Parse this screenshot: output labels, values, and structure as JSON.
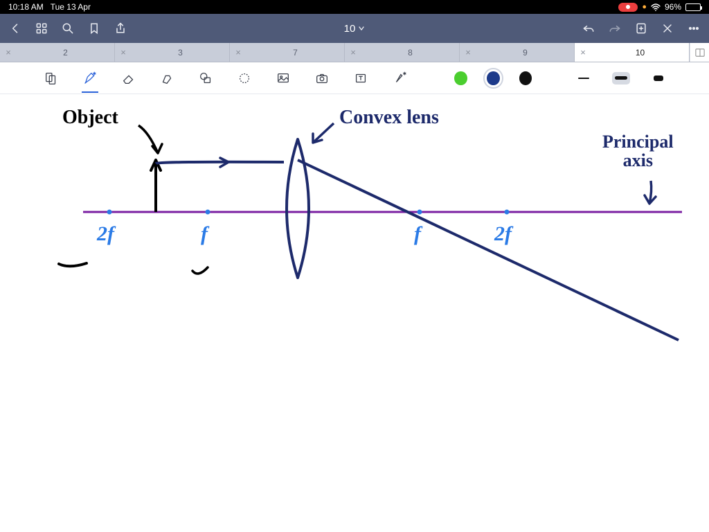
{
  "status": {
    "time": "10:18 AM",
    "date": "Tue 13 Apr",
    "battery_pct": "96%"
  },
  "toolbar": {
    "title": "10"
  },
  "tabs": [
    {
      "label": "2",
      "active": false
    },
    {
      "label": "3",
      "active": false
    },
    {
      "label": "7",
      "active": false
    },
    {
      "label": "8",
      "active": false
    },
    {
      "label": "9",
      "active": false
    },
    {
      "label": "10",
      "active": true
    }
  ],
  "colors": {
    "green": "#4bce2f",
    "navy": "#1d3a8a",
    "black": "#111111"
  },
  "diagram": {
    "label_object": "Object",
    "label_convex": "Convex lens",
    "label_principal_axis": "Principal\naxis",
    "points": {
      "left_2f": "2f",
      "left_f": "f",
      "right_f": "f",
      "right_2f": "2f"
    }
  }
}
